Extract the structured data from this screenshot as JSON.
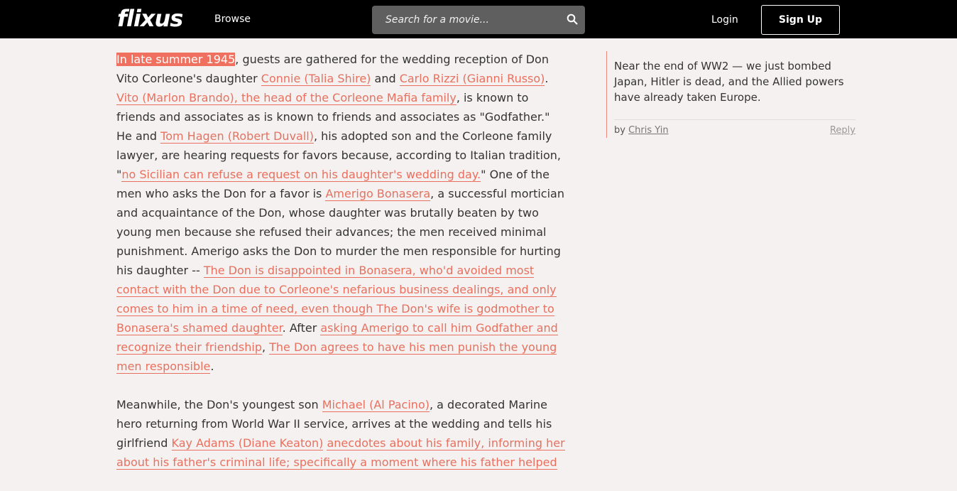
{
  "nav": {
    "logo": "flixus",
    "browse": "Browse",
    "search_placeholder": "Search for a movie...",
    "login": "Login",
    "signup": "Sign Up"
  },
  "colors": {
    "accent": "#e8705e",
    "highlight": "#f0705f",
    "topbar": "#000000",
    "background": "#f5f1f0"
  },
  "article": {
    "p1": {
      "s1": "In late summer 1945",
      "s2": ", guests are gathered for the wedding reception of Don Vito Corleone's daughter ",
      "s3": "Connie (Talia Shire)",
      "s4": " and ",
      "s5": "Carlo Rizzi (Gianni Russo)",
      "s6": ". ",
      "s7": "Vito (Marlon Brando), the head of the Corleone Mafia family",
      "s8": ", is known to friends and associates as is known to friends and associates as \"Godfather.\" He and ",
      "s9": "Tom Hagen (Robert Duvall)",
      "s10": ", his adopted son and the Corleone family lawyer, are hearing requests for favors because, according to Italian tradition, \"",
      "s11": "no Sicilian can refuse a request on his daughter's wedding day.",
      "s12": "\" One of the men who asks the Don for a favor is ",
      "s13": "Amerigo Bonasera",
      "s14": ", a successful mortician and acquaintance of the Don, whose daughter was brutally beaten by two young men because she refused their advances; the men received minimal punishment. Amerigo asks the Don to murder the men responsible for hurting his daughter -- ",
      "s15": "The Don is disappointed in Bonasera, who'd avoided most contact with the Don due to Corleone's nefarious business dealings, and only comes to him in a time of need, even though The Don's wife is godmother to Bonasera's shamed daughter",
      "s16": ". After ",
      "s17": "asking Amerigo to call him Godfather and recognize their friendship",
      "s18": ", ",
      "s19": "The Don agrees to have his men punish the young men responsible",
      "s20": "."
    },
    "p2": {
      "s1": "Meanwhile, the Don's youngest son ",
      "s2": "Michael (Al Pacino)",
      "s3": ", a decorated Marine hero returning from World War II service, arrives at the wedding and tells his girlfriend ",
      "s4": "Kay Adams (Diane Keaton)",
      "s5": " ",
      "s6": "anecdotes about his family, informing her about his father's criminal life; specifically a moment where his father helped"
    }
  },
  "comment": {
    "text": "Near the end of WW2 — we just bombed Japan, Hitler is dead, and the Allied powers have already taken Europe.",
    "by_label": "by",
    "author": "Chris Yin",
    "reply": "Reply"
  }
}
